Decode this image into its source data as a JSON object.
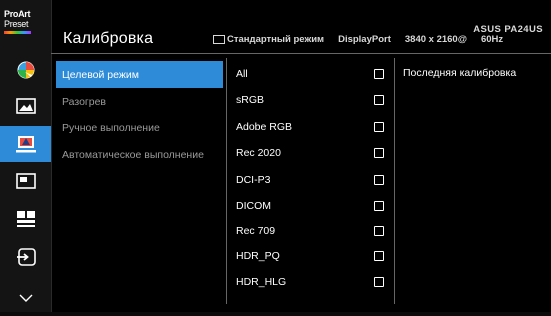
{
  "logo": {
    "line1": "ProArt",
    "line2": "Preset"
  },
  "header": {
    "title": "Калибровка",
    "model": "ASUS PA24US",
    "status": {
      "mode": "Стандартный режим",
      "input": "DisplayPort",
      "resolution": "3840 x 2160@",
      "refresh": "60Hz"
    }
  },
  "sidebar": {
    "icons": [
      {
        "name": "splendid-icon",
        "active": false
      },
      {
        "name": "image-icon",
        "active": false
      },
      {
        "name": "color-icon",
        "active": true
      },
      {
        "name": "pip-icon",
        "active": false
      },
      {
        "name": "system-setup-icon",
        "active": false
      },
      {
        "name": "input-select-icon",
        "active": false
      },
      {
        "name": "chevron-down-icon",
        "active": false
      }
    ]
  },
  "menu": {
    "items": [
      {
        "label": "Целевой режим",
        "active": true
      },
      {
        "label": "Разогрев",
        "active": false
      },
      {
        "label": "Ручное выполнение",
        "active": false
      },
      {
        "label": "Автоматическое выполнение",
        "active": false
      }
    ]
  },
  "options": {
    "items": [
      {
        "label": "All",
        "checked": false
      },
      {
        "label": "sRGB",
        "checked": false
      },
      {
        "label": "Adobe RGB",
        "checked": false
      },
      {
        "label": "Rec 2020",
        "checked": false
      },
      {
        "label": "DCI-P3",
        "checked": false
      },
      {
        "label": "DICOM",
        "checked": false
      },
      {
        "label": "Rec 709",
        "checked": false
      },
      {
        "label": "HDR_PQ",
        "checked": false
      },
      {
        "label": "HDR_HLG",
        "checked": false
      }
    ]
  },
  "info": {
    "text": "Последняя калибровка"
  },
  "colors": {
    "accent": "#2e8bd8",
    "background": "#000000",
    "muted_text": "#9a9a9a"
  }
}
